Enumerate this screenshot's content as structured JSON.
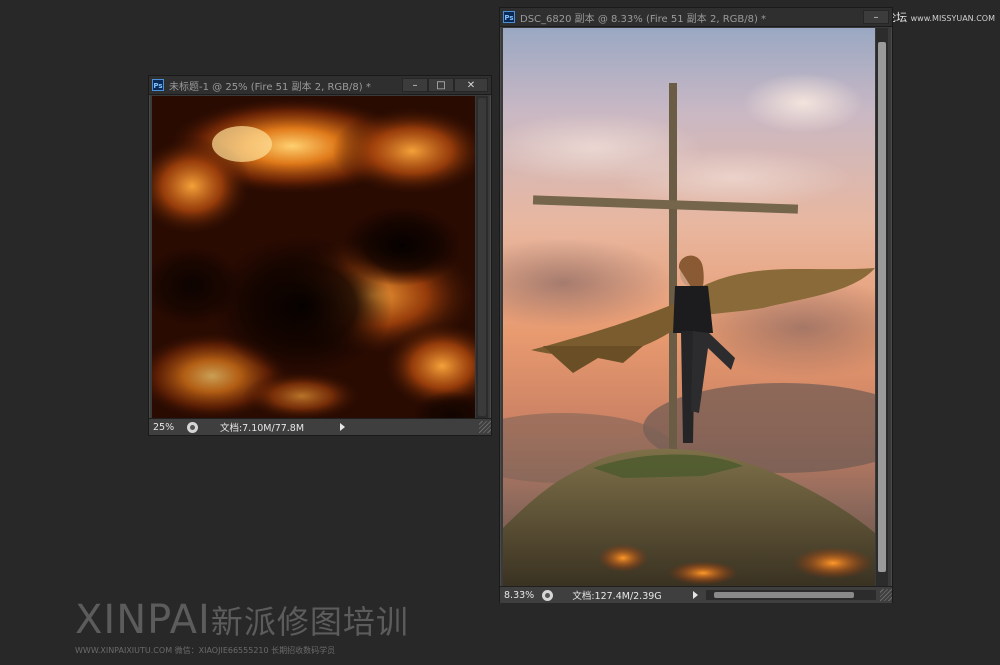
{
  "site_mark": {
    "cn": "思缘设计论坛",
    "url": "www.MISSYUAN.COM"
  },
  "window1": {
    "app_icon": "Ps",
    "title": "未标题-1 @ 25% (Fire 51 副本 2, RGB/8) *",
    "zoom": "25%",
    "doc_info": "文档:7.10M/77.8M"
  },
  "window2": {
    "app_icon": "Ps",
    "title": "DSC_6820 副本 @ 8.33% (Fire 51 副本 2, RGB/8) *",
    "zoom": "8.33%",
    "doc_info": "文档:127.4M/2.39G"
  },
  "watermark": {
    "brand": "XINPAI",
    "brand_cn": "新派修图培训",
    "line": "WWW.XINPAIXIUTU.COM   微信：XIAOJIE66555210 长期招收数码学员"
  },
  "icons": {
    "minimize": "minimize-icon",
    "maximize": "maximize-icon",
    "close": "close-icon"
  }
}
